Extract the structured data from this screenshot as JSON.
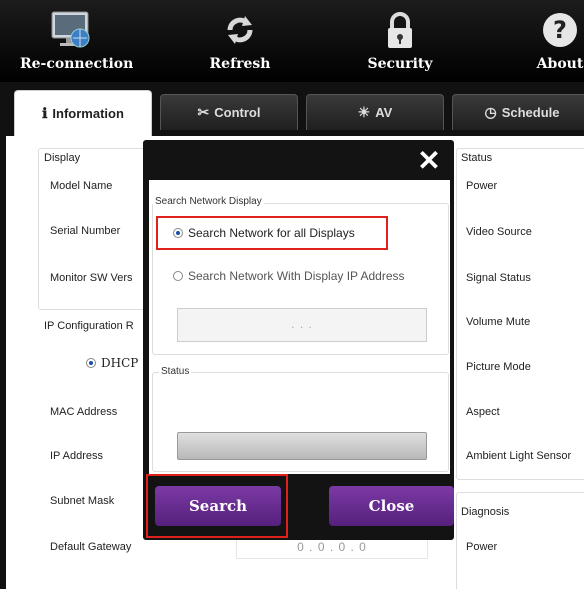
{
  "toolbar": {
    "buttons": [
      {
        "label": "Re-connection",
        "icon": "monitor-globe-icon"
      },
      {
        "label": "Refresh",
        "icon": "refresh-icon"
      },
      {
        "label": "Security",
        "icon": "padlock-icon"
      },
      {
        "label": "About",
        "icon": "question-icon"
      }
    ]
  },
  "tabs": [
    {
      "label": "Information",
      "icon": "info-icon",
      "active": true
    },
    {
      "label": "Control",
      "icon": "tools-icon"
    },
    {
      "label": "AV",
      "icon": "sun-icon"
    },
    {
      "label": "Schedule",
      "icon": "clock-icon"
    }
  ],
  "left_panel": {
    "display_legend": "Display",
    "model_name": "Model Name",
    "serial_number": "Serial Number",
    "monitor_sw": "Monitor SW Vers",
    "ip_config": "IP Configuration R",
    "dhcp": "DHCP",
    "mac": "MAC Address",
    "ip": "IP Address",
    "subnet": "Subnet Mask",
    "gateway": "Default Gateway",
    "gateway_value": "0 . 0 . 0 . 0"
  },
  "right_panel": {
    "status_legend": "Status",
    "power": "Power",
    "video_source": "Video Source",
    "signal_status": "Signal Status",
    "volume_mute": "Volume Mute",
    "picture_mode": "Picture Mode",
    "aspect": "Aspect",
    "ambient_light": "Ambient Light Sensor",
    "diagnosis_legend": "Diagnosis",
    "diag_power": "Power"
  },
  "dialog": {
    "close_glyph": "✕",
    "search_legend": "Search Network Display",
    "option_all": "Search Network for all Displays",
    "option_ip": "Search Network With Display IP Address",
    "ip_placeholder": ".        .        .",
    "status_legend": "Status",
    "progress": 0,
    "search_button": "Search",
    "close_button": "Close"
  },
  "colors": {
    "accent_purple": "#6a2c94",
    "highlight_red": "#e0201c",
    "radio_selected": "#1a4ea8"
  }
}
